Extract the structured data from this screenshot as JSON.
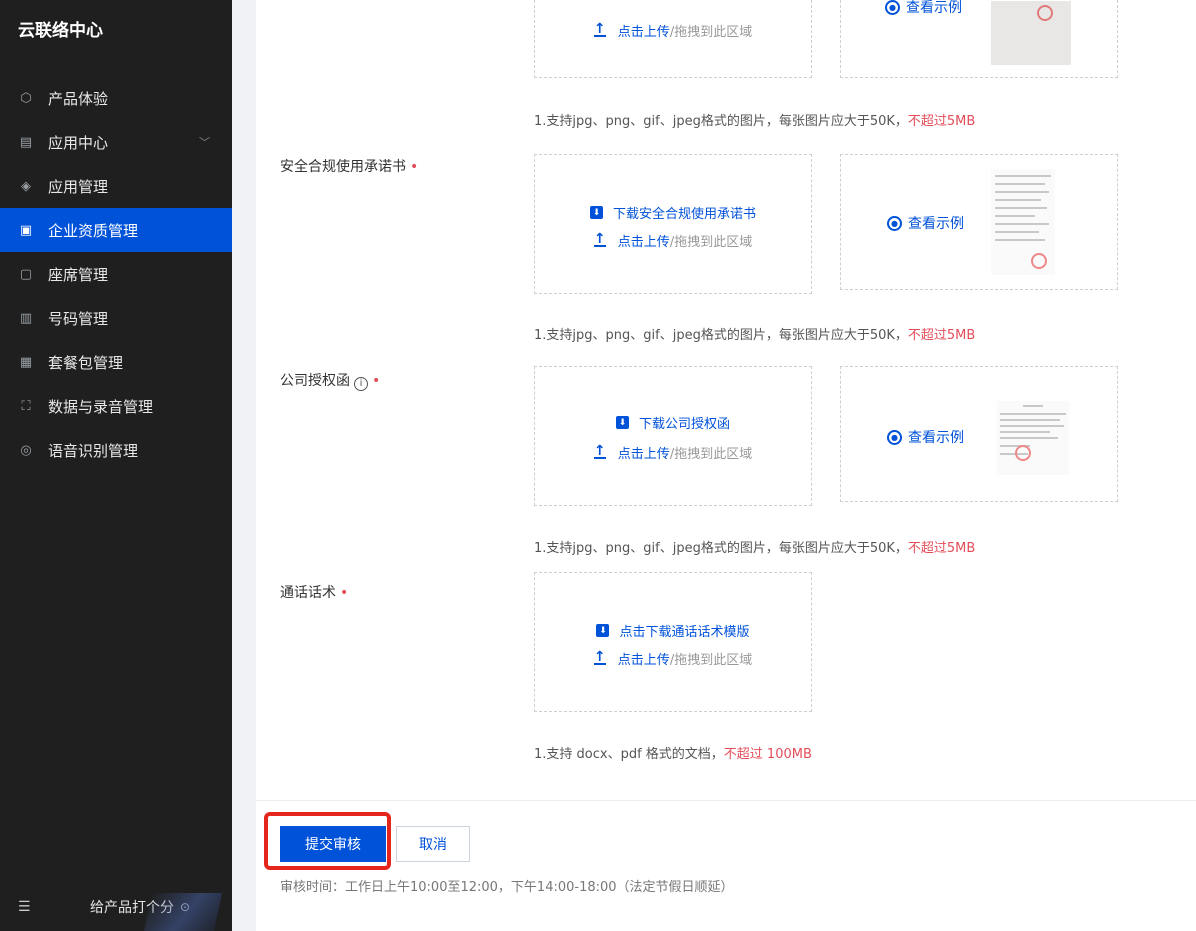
{
  "sidebar": {
    "title": "云联络中心",
    "items": [
      {
        "label": "产品体验",
        "icon": "cube-icon"
      },
      {
        "label": "应用中心",
        "icon": "grid-icon"
      },
      {
        "label": "应用管理",
        "icon": "layers-icon"
      },
      {
        "label": "企业资质管理",
        "icon": "folder-icon"
      },
      {
        "label": "座席管理",
        "icon": "agent-icon"
      },
      {
        "label": "号码管理",
        "icon": "list-icon"
      },
      {
        "label": "套餐包管理",
        "icon": "package-icon"
      },
      {
        "label": "数据与录音管理",
        "icon": "scan-icon"
      },
      {
        "label": "语音识别管理",
        "icon": "voice-icon"
      }
    ],
    "active_index": 3,
    "rate_label": "给产品打个分"
  },
  "common": {
    "upload_link": "点击上传",
    "upload_hint": "/拖拽到此区域",
    "view_example": "查看示例",
    "image_hint": "1.支持jpg、png、gif、jpeg格式的图片，每张图片应大于50K，",
    "image_limit": "不超过5MB"
  },
  "rows": {
    "commitment": {
      "label": "安全合规使用承诺书",
      "download": "下载安全合规使用承诺书"
    },
    "authorization": {
      "label": "公司授权函",
      "download": "下载公司授权函"
    },
    "script": {
      "label": "通话话术",
      "download": "点击下载通话话术模版",
      "hint": "1.支持 docx、pdf 格式的文档，",
      "limit": "不超过 100MB"
    }
  },
  "actions": {
    "submit": "提交审核",
    "cancel": "取消",
    "review_time": "审核时间：工作日上午10:00至12:00，下午14:00-18:00（法定节假日顺延）"
  },
  "colors": {
    "primary": "#0052d9",
    "danger": "#e34d59",
    "sidebar_bg": "#1f1f1f",
    "highlight": "#e5261c"
  }
}
